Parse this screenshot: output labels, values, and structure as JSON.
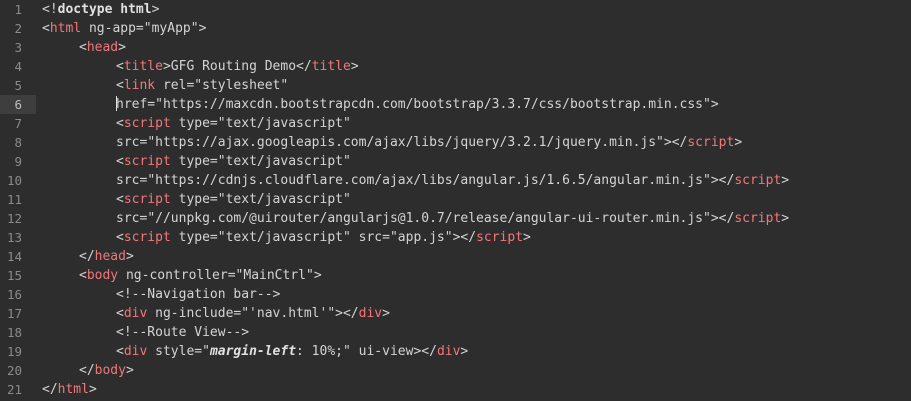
{
  "editor": {
    "active_line": 6,
    "colors": {
      "background": "#2d2d2d",
      "tag": "#f2777a",
      "text": "#d4d4d4",
      "gutter_text": "#8a8a8a"
    },
    "lines": [
      {
        "n": "1",
        "indent": 0,
        "tokens": [
          {
            "t": "bracket",
            "v": "<!"
          },
          {
            "t": "doctype",
            "v": "doctype html"
          },
          {
            "t": "bracket",
            "v": ">"
          }
        ]
      },
      {
        "n": "2",
        "indent": 0,
        "tokens": [
          {
            "t": "bracket",
            "v": "<"
          },
          {
            "t": "tag",
            "v": "html"
          },
          {
            "t": "attr",
            "v": " ng-app="
          },
          {
            "t": "str",
            "v": "\"myApp\""
          },
          {
            "t": "bracket",
            "v": ">"
          }
        ]
      },
      {
        "n": "3",
        "indent": 1,
        "tokens": [
          {
            "t": "bracket",
            "v": "<"
          },
          {
            "t": "tag",
            "v": "head"
          },
          {
            "t": "bracket",
            "v": ">"
          }
        ]
      },
      {
        "n": "4",
        "indent": 2,
        "tokens": [
          {
            "t": "bracket",
            "v": "<"
          },
          {
            "t": "tag",
            "v": "title"
          },
          {
            "t": "bracket",
            "v": ">"
          },
          {
            "t": "text",
            "v": "GFG Routing Demo"
          },
          {
            "t": "bracket",
            "v": "</"
          },
          {
            "t": "tag",
            "v": "title"
          },
          {
            "t": "bracket",
            "v": ">"
          }
        ]
      },
      {
        "n": "5",
        "indent": 2,
        "tokens": [
          {
            "t": "bracket",
            "v": "<"
          },
          {
            "t": "tag",
            "v": "link"
          },
          {
            "t": "attr",
            "v": " rel="
          },
          {
            "t": "str",
            "v": "\"stylesheet\""
          }
        ]
      },
      {
        "n": "6",
        "indent": 2,
        "cursor": true,
        "tokens": [
          {
            "t": "attr",
            "v": "href="
          },
          {
            "t": "str",
            "v": "\"https://maxcdn.bootstrapcdn.com/bootstrap/3.3.7/css/bootstrap.min.css\""
          },
          {
            "t": "bracket",
            "v": ">"
          }
        ]
      },
      {
        "n": "7",
        "indent": 2,
        "tokens": [
          {
            "t": "bracket",
            "v": "<"
          },
          {
            "t": "tag",
            "v": "script"
          },
          {
            "t": "attr",
            "v": " type="
          },
          {
            "t": "str",
            "v": "\"text/javascript\""
          }
        ]
      },
      {
        "n": "8",
        "indent": 2,
        "tokens": [
          {
            "t": "attr",
            "v": "src="
          },
          {
            "t": "str",
            "v": "\"https://ajax.googleapis.com/ajax/libs/jquery/3.2.1/jquery.min.js\""
          },
          {
            "t": "bracket",
            "v": "></"
          },
          {
            "t": "tag",
            "v": "script"
          },
          {
            "t": "bracket",
            "v": ">"
          }
        ]
      },
      {
        "n": "9",
        "indent": 2,
        "tokens": [
          {
            "t": "bracket",
            "v": "<"
          },
          {
            "t": "tag",
            "v": "script"
          },
          {
            "t": "attr",
            "v": " type="
          },
          {
            "t": "str",
            "v": "\"text/javascript\""
          }
        ]
      },
      {
        "n": "10",
        "indent": 2,
        "tokens": [
          {
            "t": "attr",
            "v": "src="
          },
          {
            "t": "str",
            "v": "\"https://cdnjs.cloudflare.com/ajax/libs/angular.js/1.6.5/angular.min.js\""
          },
          {
            "t": "bracket",
            "v": "></"
          },
          {
            "t": "tag",
            "v": "script"
          },
          {
            "t": "bracket",
            "v": ">"
          }
        ]
      },
      {
        "n": "11",
        "indent": 2,
        "tokens": [
          {
            "t": "bracket",
            "v": "<"
          },
          {
            "t": "tag",
            "v": "script"
          },
          {
            "t": "attr",
            "v": " type="
          },
          {
            "t": "str",
            "v": "\"text/javascript\""
          }
        ]
      },
      {
        "n": "12",
        "indent": 2,
        "tokens": [
          {
            "t": "attr",
            "v": "src="
          },
          {
            "t": "str",
            "v": "\"//unpkg.com/@uirouter/angularjs@1.0.7/release/angular-ui-router.min.js\""
          },
          {
            "t": "bracket",
            "v": "></"
          },
          {
            "t": "tag",
            "v": "script"
          },
          {
            "t": "bracket",
            "v": ">"
          }
        ]
      },
      {
        "n": "13",
        "indent": 2,
        "tokens": [
          {
            "t": "bracket",
            "v": "<"
          },
          {
            "t": "tag",
            "v": "script"
          },
          {
            "t": "attr",
            "v": " type="
          },
          {
            "t": "str",
            "v": "\"text/javascript\""
          },
          {
            "t": "attr",
            "v": " src="
          },
          {
            "t": "str",
            "v": "\"app.js\""
          },
          {
            "t": "bracket",
            "v": "></"
          },
          {
            "t": "tag",
            "v": "script"
          },
          {
            "t": "bracket",
            "v": ">"
          }
        ]
      },
      {
        "n": "14",
        "indent": 1,
        "tokens": [
          {
            "t": "bracket",
            "v": "</"
          },
          {
            "t": "tag",
            "v": "head"
          },
          {
            "t": "bracket",
            "v": ">"
          }
        ]
      },
      {
        "n": "15",
        "indent": 1,
        "tokens": [
          {
            "t": "bracket",
            "v": "<"
          },
          {
            "t": "tag",
            "v": "body"
          },
          {
            "t": "attr",
            "v": " ng-controller="
          },
          {
            "t": "str",
            "v": "\"MainCtrl\""
          },
          {
            "t": "bracket",
            "v": ">"
          }
        ]
      },
      {
        "n": "16",
        "indent": 2,
        "tokens": [
          {
            "t": "comment",
            "v": "<!--Navigation bar-->"
          }
        ]
      },
      {
        "n": "17",
        "indent": 2,
        "tokens": [
          {
            "t": "bracket",
            "v": "<"
          },
          {
            "t": "tag",
            "v": "div"
          },
          {
            "t": "attr",
            "v": " ng-include="
          },
          {
            "t": "str",
            "v": "\"'nav.html'\""
          },
          {
            "t": "bracket",
            "v": "></"
          },
          {
            "t": "tag",
            "v": "div"
          },
          {
            "t": "bracket",
            "v": ">"
          }
        ]
      },
      {
        "n": "18",
        "indent": 2,
        "tokens": [
          {
            "t": "comment",
            "v": "<!--Route View-->"
          }
        ]
      },
      {
        "n": "19",
        "indent": 2,
        "tokens": [
          {
            "t": "bracket",
            "v": "<"
          },
          {
            "t": "tag",
            "v": "div"
          },
          {
            "t": "attr",
            "v": " style="
          },
          {
            "t": "str",
            "v": "\""
          },
          {
            "t": "css-prop",
            "v": "margin-left"
          },
          {
            "t": "css-val",
            "v": ": 10%;"
          },
          {
            "t": "str",
            "v": "\""
          },
          {
            "t": "attr",
            "v": " ui-view"
          },
          {
            "t": "bracket",
            "v": "></"
          },
          {
            "t": "tag",
            "v": "div"
          },
          {
            "t": "bracket",
            "v": ">"
          }
        ]
      },
      {
        "n": "20",
        "indent": 1,
        "tokens": [
          {
            "t": "bracket",
            "v": "</"
          },
          {
            "t": "tag",
            "v": "body"
          },
          {
            "t": "bracket",
            "v": ">"
          }
        ]
      },
      {
        "n": "21",
        "indent": 0,
        "tokens": [
          {
            "t": "bracket",
            "v": "</"
          },
          {
            "t": "tag",
            "v": "html"
          },
          {
            "t": "bracket",
            "v": ">"
          }
        ]
      }
    ]
  }
}
